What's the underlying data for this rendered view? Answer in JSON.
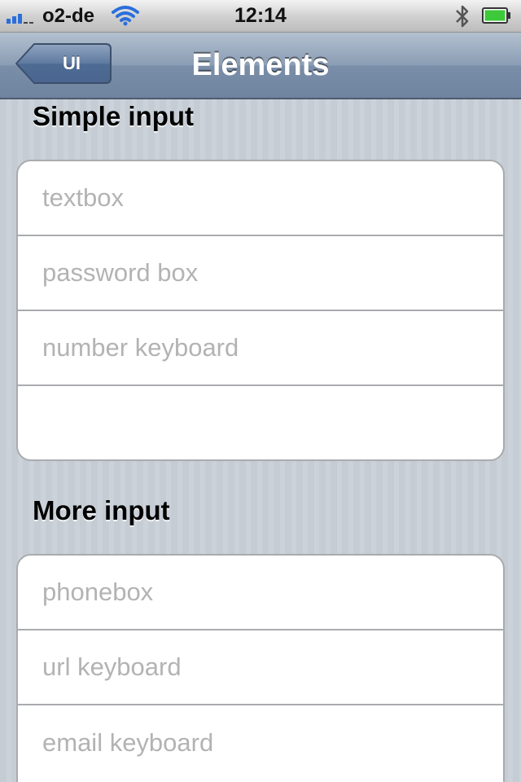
{
  "status_bar": {
    "carrier": "o2-de",
    "time": "12:14",
    "signal_bars_filled": 3,
    "signal_bars_total": 5
  },
  "nav_bar": {
    "title": "Elements",
    "back_label": "UI"
  },
  "sections": [
    {
      "header": "Simple input",
      "fields": [
        {
          "placeholder": "textbox",
          "value": ""
        },
        {
          "placeholder": "password box",
          "value": ""
        },
        {
          "placeholder": "number keyboard",
          "value": ""
        },
        {
          "placeholder": "",
          "value": ""
        }
      ]
    },
    {
      "header": "More input",
      "fields": [
        {
          "placeholder": "phonebox",
          "value": ""
        },
        {
          "placeholder": "url keyboard",
          "value": ""
        },
        {
          "placeholder": "email keyboard",
          "value": ""
        }
      ]
    }
  ],
  "colors": {
    "signal_blue": "#2a6edb",
    "battery_green": "#3ec93a",
    "nav_bar": "#6f84a0",
    "placeholder_gray": "#b3b3b3",
    "background": "#c5ccd4"
  },
  "icons": {
    "signal": "signal-strength-icon",
    "wifi": "wifi-icon",
    "bluetooth": "bluetooth-icon",
    "battery": "battery-icon",
    "back": "back-arrow-button"
  }
}
